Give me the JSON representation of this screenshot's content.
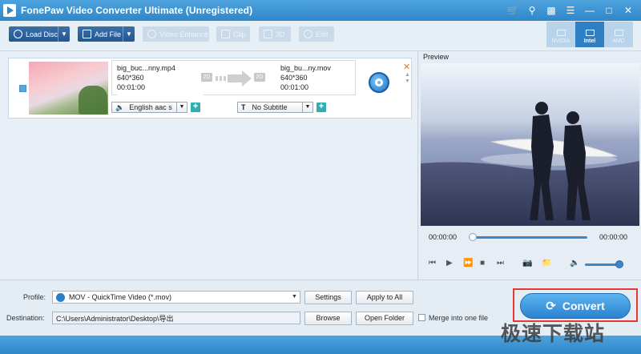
{
  "window": {
    "title": "FonePaw Video Converter Ultimate (Unregistered)"
  },
  "title_icons": [
    "cart-icon",
    "key-icon",
    "feedback-icon",
    "menu-icon",
    "minimize-icon",
    "restore-icon",
    "close-icon"
  ],
  "toolbar": {
    "load_disc": "Load Disc",
    "add_file": "Add File",
    "video_enhance": "Video Enhance",
    "clip": "Clip",
    "three_d": "3D",
    "edit": "Edit"
  },
  "gpu": {
    "nvidia": "NVIDIA",
    "intel": "Intel",
    "amd": "AMD",
    "active": "Intel"
  },
  "file": {
    "source_name": "big_buc...nny.mp4",
    "source_resolution": "640*360",
    "source_duration": "00:01:00",
    "badge_src": "2D",
    "badge_dst": "2D",
    "output_name": "big_bu...ny.mov",
    "output_resolution": "640*360",
    "output_duration": "00:01:00",
    "audio_track": "English aac s",
    "subtitle": "No Subtitle"
  },
  "preview": {
    "label": "Preview",
    "time_current": "00:00:00",
    "time_total": "00:00:00",
    "progress": 0,
    "volume": 0.9
  },
  "bottom": {
    "profile_label": "Profile:",
    "profile_value": "MOV - QuickTime Video (*.mov)",
    "settings": "Settings",
    "apply_to_all": "Apply to All",
    "destination_label": "Destination:",
    "destination_value": "C:\\Users\\Administrator\\Desktop\\导出",
    "browse": "Browse",
    "open_folder": "Open Folder",
    "merge_label": "Merge into one file",
    "convert": "Convert"
  },
  "watermark": "极速下载站",
  "colors": {
    "accent": "#2f86c9",
    "convert_button": "#3a94dc",
    "highlight_frame": "#e53935"
  }
}
